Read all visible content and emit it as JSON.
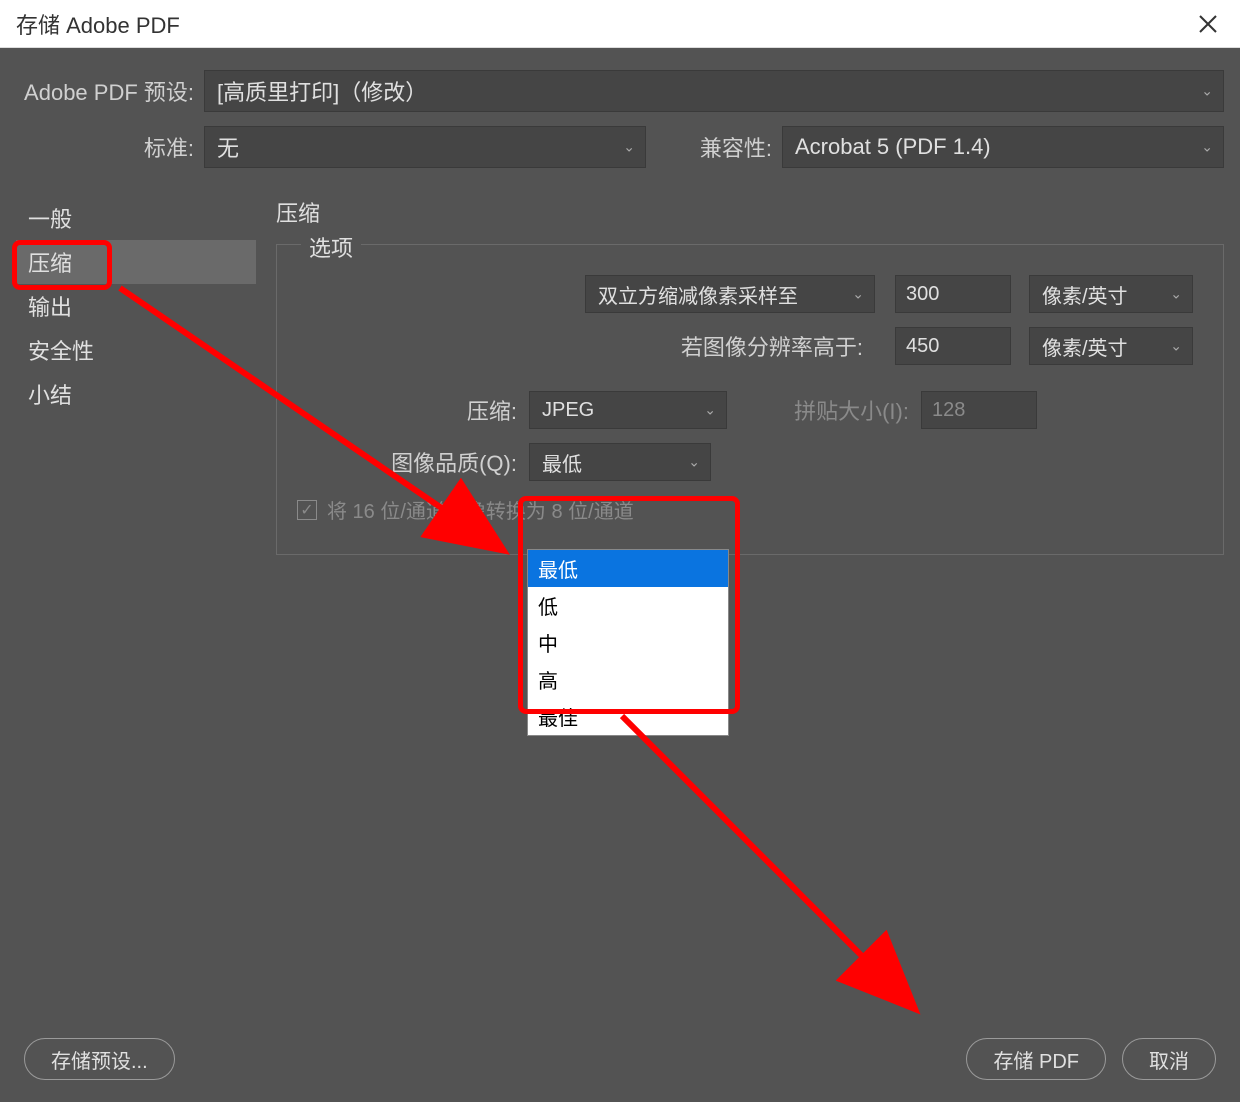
{
  "title": "存储 Adobe PDF",
  "header": {
    "preset_label": "Adobe PDF 预设:",
    "preset_value": "[高质里打印]（修改）",
    "standard_label": "标准:",
    "standard_value": "无",
    "compat_label": "兼容性:",
    "compat_value": "Acrobat 5 (PDF 1.4)"
  },
  "sidebar": {
    "items": [
      {
        "label": "一般"
      },
      {
        "label": "压缩"
      },
      {
        "label": "输出"
      },
      {
        "label": "安全性"
      },
      {
        "label": "小结"
      }
    ],
    "selected": "压缩"
  },
  "main": {
    "section_title": "压缩",
    "fieldset_legend": "选项",
    "downsampling_method": "双立方缩减像素采样至",
    "downsampling_value": "300",
    "downsampling_unit": "像素/英寸",
    "threshold_label": "若图像分辨率高于:",
    "threshold_value": "450",
    "threshold_unit": "像素/英寸",
    "compression_label": "压缩:",
    "compression_value": "JPEG",
    "tilesize_label": "拼贴大小(I):",
    "tilesize_value": "128",
    "quality_label": "图像品质(Q):",
    "quality_value": "最低",
    "checkbox_label": "将 16 位/通道图像转换为 8 位/通道"
  },
  "dropdown": {
    "options": [
      "最低",
      "低",
      "中",
      "高",
      "最佳"
    ],
    "selected": "最低"
  },
  "footer": {
    "save_preset": "存储预设...",
    "save_pdf": "存储 PDF",
    "cancel": "取消"
  }
}
